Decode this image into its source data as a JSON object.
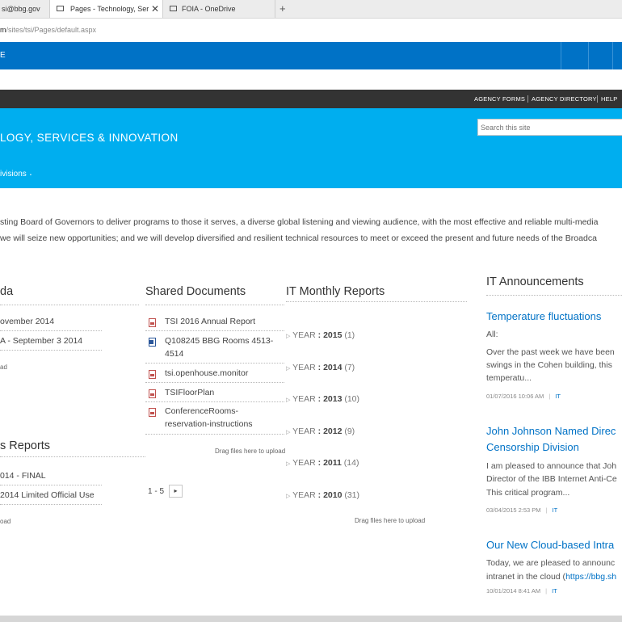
{
  "browser": {
    "tabs": [
      {
        "label": "si@bbg.gov"
      },
      {
        "label": "Pages - Technology, Ser",
        "active": true
      },
      {
        "label": "FOIA - OneDrive"
      }
    ],
    "new_tab": "+",
    "close_glyph": "✕",
    "url_host": "m",
    "url_path": "/sites/tsi/Pages/default.aspx"
  },
  "suite_bar": {
    "text": "E"
  },
  "top_nav": {
    "links": [
      "AGENCY FORMS",
      "AGENCY DIRECTORY",
      "HELP"
    ]
  },
  "site": {
    "title": "LOGY, SERVICES & INNOVATION",
    "nav_item": "ivisions",
    "search_placeholder": "Search this site"
  },
  "description": {
    "line1": "sting Board of Governors to deliver programs to those it serves, a diverse global listening and viewing audience, with the most effective and reliable multi-media",
    "line2": "we will seize new opportunities; and we will develop diversified and resilient technical resources to meet or exceed the present and future needs of the Broadca"
  },
  "agenda": {
    "heading": "da",
    "items": [
      "ovember 2014",
      "A - September 3 2014"
    ],
    "drag_text": "ad"
  },
  "status_reports": {
    "heading": "s Reports",
    "items": [
      "014 - FINAL",
      "2014 Limited Official Use"
    ],
    "drag_text": "oad"
  },
  "shared_documents": {
    "heading": "Shared Documents",
    "items": [
      {
        "type": "pdf-icon",
        "lines": [
          "TSI 2016 Annual Report"
        ]
      },
      {
        "type": "word-icon",
        "lines": [
          "Q108245 BBG Rooms 4513-",
          "4514"
        ]
      },
      {
        "type": "pdf-icon",
        "lines": [
          "tsi.openhouse.monitor"
        ]
      },
      {
        "type": "pdf-icon",
        "lines": [
          "TSIFloorPlan"
        ]
      },
      {
        "type": "pdf-icon",
        "lines": [
          "ConferenceRooms-",
          "reservation-instructions"
        ]
      }
    ],
    "drag_text": "Drag files here to upload",
    "pager_text": "1 - 5",
    "pager_next": "▸"
  },
  "monthly_reports": {
    "heading": "IT Monthly Reports",
    "year_label": "YEAR",
    "groups": [
      {
        "year": "2015",
        "count": "(1)"
      },
      {
        "year": "2014",
        "count": "(7)"
      },
      {
        "year": "2013",
        "count": "(10)"
      },
      {
        "year": "2012",
        "count": "(9)"
      },
      {
        "year": "2011",
        "count": "(14)"
      },
      {
        "year": "2010",
        "count": "(31)"
      }
    ],
    "drag_text": "Drag files here to upload"
  },
  "announcements": {
    "heading": "IT Announcements",
    "items": [
      {
        "title_lines": [
          "Temperature fluctuations"
        ],
        "body_lines": [
          "All:",
          "Over the past week we have been",
          "swings in the Cohen building, this",
          "temperatu..."
        ],
        "date": "01/07/2016 10:06 AM",
        "tag": "IT"
      },
      {
        "title_lines": [
          "John Johnson Named Direc",
          "Censorship Division"
        ],
        "body_lines": [
          "I am pleased to announce that Joh",
          "Director of the IBB Internet Anti-Ce",
          "This critical program..."
        ],
        "date": "03/04/2015 2:53 PM",
        "tag": "IT"
      },
      {
        "title_lines": [
          "Our New Cloud-based Intra"
        ],
        "body_lines": [
          "Today, we are pleased to announc",
          "intranet in the cloud ("
        ],
        "body_link": "https://bbg.sh",
        "date": "10/01/2014 8:41 AM",
        "tag": "IT"
      }
    ]
  },
  "colors": {
    "suite_bar": "#0072c6",
    "top_nav": "#333333",
    "header": "#00aeef",
    "link": "#0072c6"
  }
}
